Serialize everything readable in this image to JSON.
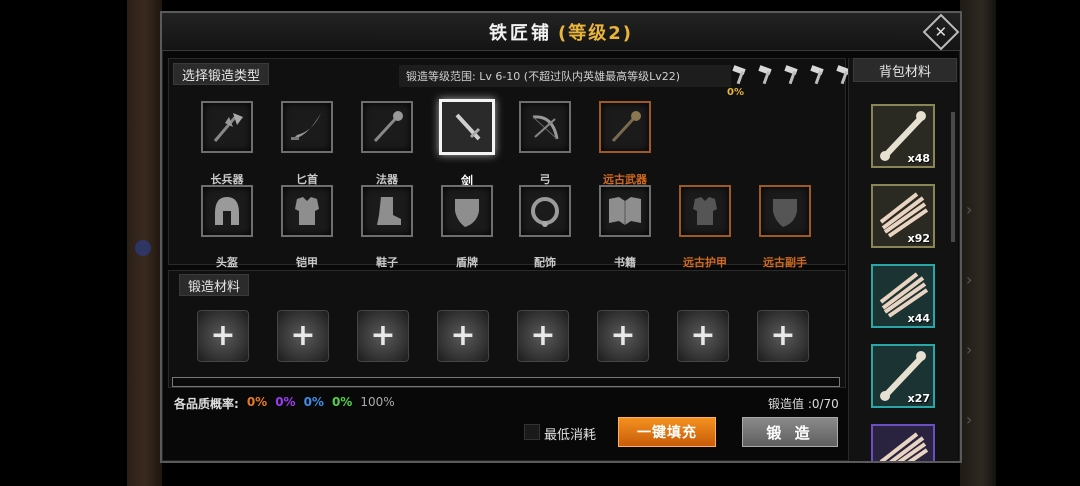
{
  "title": {
    "name": "铁匠铺",
    "level": "(等级2)"
  },
  "type_section": {
    "label": "选择锻造类型",
    "range_text": "锻造等级范围: Lv 6-10  (不超过队内英雄最高等级Lv22)",
    "success_percent": "0%",
    "hammer_count": 5,
    "row1": [
      {
        "label": "长兵器",
        "icon": "halberd-icon",
        "state": "normal"
      },
      {
        "label": "匕首",
        "icon": "dagger-icon",
        "state": "normal"
      },
      {
        "label": "法器",
        "icon": "staff-icon",
        "state": "normal"
      },
      {
        "label": "剑",
        "icon": "sword-icon",
        "state": "selected"
      },
      {
        "label": "弓",
        "icon": "bow-icon",
        "state": "normal"
      },
      {
        "label": "远古武器",
        "icon": "ancient-weapon-icon",
        "state": "ancient"
      }
    ],
    "row2": [
      {
        "label": "头盔",
        "icon": "helmet-icon",
        "state": "normal"
      },
      {
        "label": "铠甲",
        "icon": "armor-icon",
        "state": "normal"
      },
      {
        "label": "鞋子",
        "icon": "boot-icon",
        "state": "normal"
      },
      {
        "label": "盾牌",
        "icon": "shield-icon",
        "state": "normal"
      },
      {
        "label": "配饰",
        "icon": "necklace-icon",
        "state": "normal"
      },
      {
        "label": "书籍",
        "icon": "book-icon",
        "state": "normal"
      },
      {
        "label": "远古护甲",
        "icon": "ancient-armor-icon",
        "state": "ancient"
      },
      {
        "label": "远古副手",
        "icon": "ancient-offhand-icon",
        "state": "ancient"
      }
    ]
  },
  "material_section": {
    "label": "锻造材料",
    "slot_count": 8,
    "slot_symbol": "+"
  },
  "progress_fraction": 0,
  "quality": {
    "label": "各品质概率:",
    "values": [
      "0%",
      "0%",
      "0%",
      "0%",
      "100%"
    ],
    "colors": [
      "#e67a22",
      "#9b3cf0",
      "#3c8fe8",
      "#52d04a",
      "#aaaaaa"
    ]
  },
  "forge_value": "锻造值 :0/70",
  "min_cost_label": "最低消耗",
  "fill_button": "一键填充",
  "forge_button": "锻 造",
  "bag": {
    "title": "背包材料",
    "items": [
      {
        "icon": "bone-icon",
        "count": "x48",
        "rarity": "common"
      },
      {
        "icon": "fur-icon",
        "count": "x92",
        "rarity": "common"
      },
      {
        "icon": "fur-icon",
        "count": "x44",
        "rarity": "rare"
      },
      {
        "icon": "bone-icon",
        "count": "x27",
        "rarity": "rare"
      },
      {
        "icon": "fur-icon",
        "count": "",
        "rarity": "epic"
      }
    ]
  },
  "close_symbol": "✕"
}
